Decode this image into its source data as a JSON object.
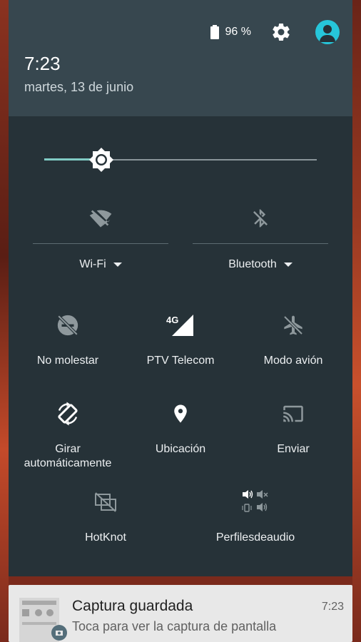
{
  "status_bar": {
    "battery_percent": "96 %",
    "settings_icon": "gear-icon",
    "user_icon": "account-circle-icon",
    "user_color": "#26c6da"
  },
  "header": {
    "time": "7:23",
    "date": "martes, 13 de junio"
  },
  "brightness": {
    "level": 0.21,
    "icon": "brightness-icon",
    "accent": "#80cbc4"
  },
  "big_tiles": [
    {
      "label": "Wi-Fi",
      "icon": "wifi-off-icon",
      "state": "off"
    },
    {
      "label": "Bluetooth",
      "icon": "bluetooth-disabled-icon",
      "state": "off"
    }
  ],
  "tiles": [
    {
      "label": "No molestar",
      "icon": "do-not-disturb-off-icon"
    },
    {
      "label": "PTV Telecom",
      "icon": "signal-4g-icon",
      "badge": "4G"
    },
    {
      "label": "Modo avión",
      "icon": "airplane-off-icon"
    },
    {
      "label": "Girar automáticamente",
      "icon": "screen-rotation-icon"
    },
    {
      "label": "Ubicación",
      "icon": "location-pin-icon"
    },
    {
      "label": "Enviar",
      "icon": "cast-icon"
    },
    {
      "label": "HotKnot",
      "icon": "hotknot-icon"
    },
    {
      "label": "Perfilesdeaudio",
      "icon": "audio-profiles-icon"
    }
  ],
  "notification": {
    "title": "Captura guardada",
    "text": "Toca para ver la captura de pantalla",
    "time": "7:23",
    "icon": "screenshot-icon"
  },
  "colors": {
    "shade_bg": "#263238",
    "header_bg": "#37474f"
  }
}
